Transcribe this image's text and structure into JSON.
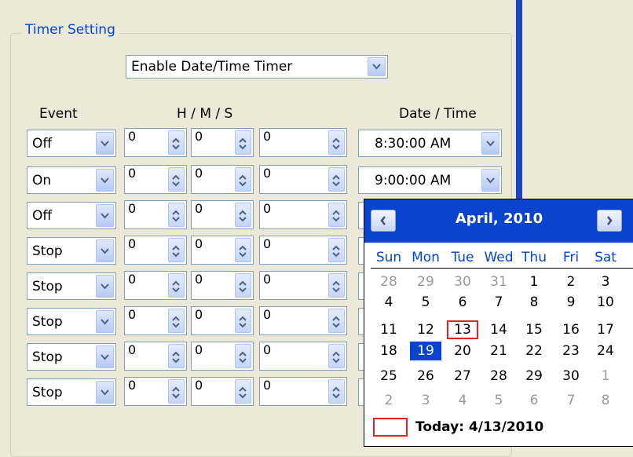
{
  "group": {
    "legend": "Timer Setting"
  },
  "timer_mode": {
    "value": "Enable Date/Time Timer"
  },
  "headers": {
    "event": "Event",
    "hms": "H / M / S",
    "datetime": "Date / Time"
  },
  "rows": [
    {
      "event": "Off",
      "h": "0",
      "m": "0",
      "s": "0",
      "datetime": "8:30:00 AM"
    },
    {
      "event": "On",
      "h": "0",
      "m": "0",
      "s": "0",
      "datetime": "9:00:00 AM"
    },
    {
      "event": "Off",
      "h": "0",
      "m": "0",
      "s": "0",
      "datetime": ""
    },
    {
      "event": "Stop",
      "h": "0",
      "m": "0",
      "s": "0",
      "datetime": ""
    },
    {
      "event": "Stop",
      "h": "0",
      "m": "0",
      "s": "0",
      "datetime": ""
    },
    {
      "event": "Stop",
      "h": "0",
      "m": "0",
      "s": "0",
      "datetime": ""
    },
    {
      "event": "Stop",
      "h": "0",
      "m": "0",
      "s": "0",
      "datetime": ""
    },
    {
      "event": "Stop",
      "h": "0",
      "m": "0",
      "s": "0",
      "datetime": ""
    }
  ],
  "calendar": {
    "month_label": "April, 2010",
    "weekdays": [
      "Sun",
      "Mon",
      "Tue",
      "Wed",
      "Thu",
      "Fri",
      "Sat"
    ],
    "weeks": [
      [
        "28",
        "29",
        "30",
        "31",
        "1",
        "2",
        "3"
      ],
      [
        "4",
        "5",
        "6",
        "7",
        "8",
        "9",
        "10"
      ],
      [
        "11",
        "12",
        "13",
        "14",
        "15",
        "16",
        "17"
      ],
      [
        "18",
        "19",
        "20",
        "21",
        "22",
        "23",
        "24"
      ],
      [
        "25",
        "26",
        "27",
        "28",
        "29",
        "30",
        "1"
      ],
      [
        "2",
        "3",
        "4",
        "5",
        "6",
        "7",
        "8"
      ]
    ],
    "selected_day": "19",
    "today_day": "13",
    "today_label": "Today: 4/13/2010"
  },
  "colors": {
    "accent": "#0a44cc",
    "today_border": "#dd2222",
    "header_text": "#0046d5"
  }
}
